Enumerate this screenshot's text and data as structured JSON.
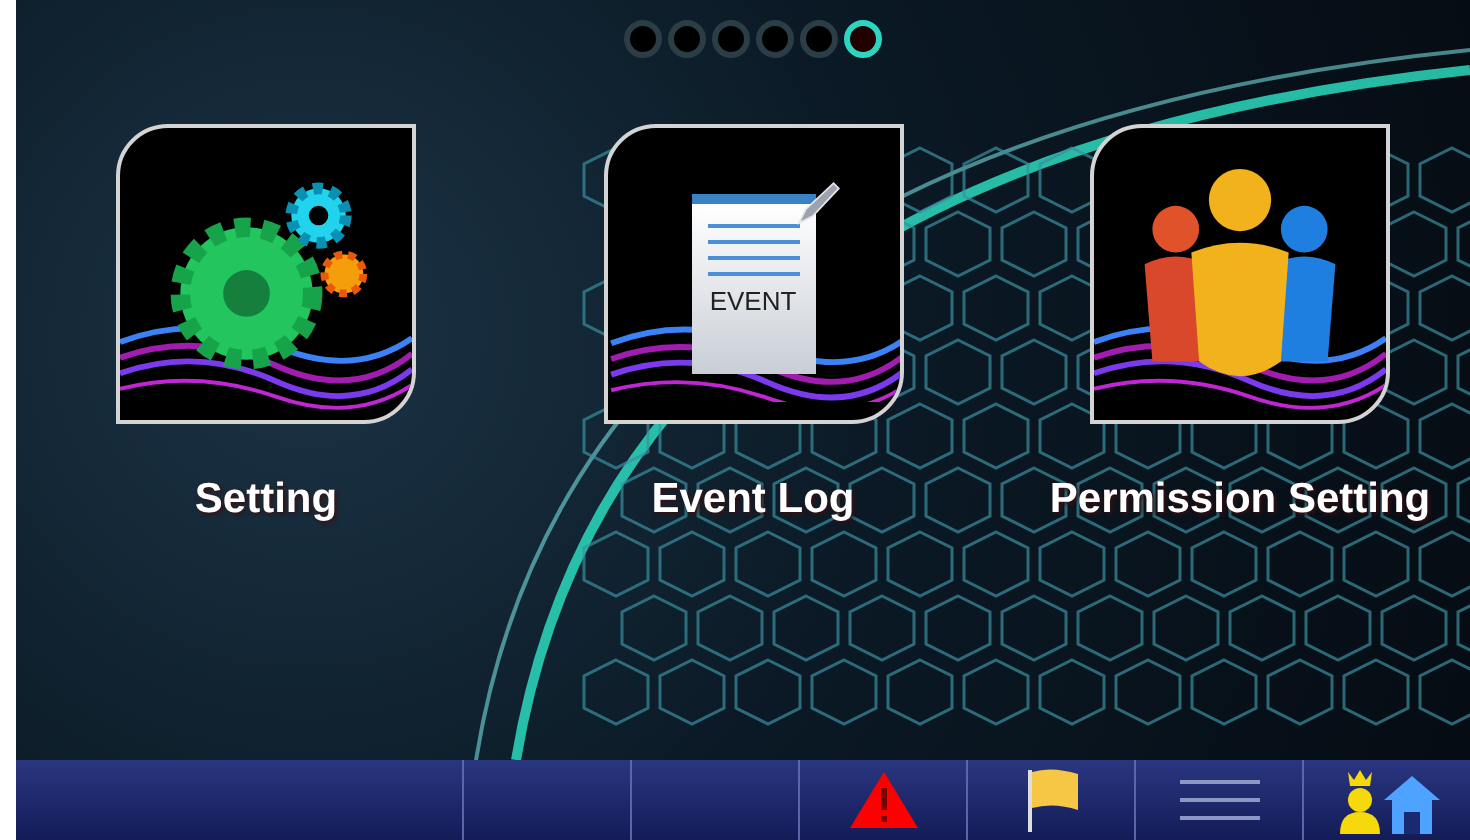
{
  "page_dots": [
    {
      "selected": false
    },
    {
      "selected": false
    },
    {
      "selected": false
    },
    {
      "selected": false
    },
    {
      "selected": false
    },
    {
      "selected": true
    }
  ],
  "apps": [
    {
      "kind": "gear",
      "label": "Setting"
    },
    {
      "kind": "document",
      "label": "Event Log",
      "icon_text": "EVENT"
    },
    {
      "kind": "people",
      "label": "Permission Setting"
    }
  ],
  "status_bar": [
    {
      "kind": "blank"
    },
    {
      "kind": "blank"
    },
    {
      "kind": "warning"
    },
    {
      "kind": "flag"
    },
    {
      "kind": "menu"
    },
    {
      "kind": "user-home"
    }
  ]
}
